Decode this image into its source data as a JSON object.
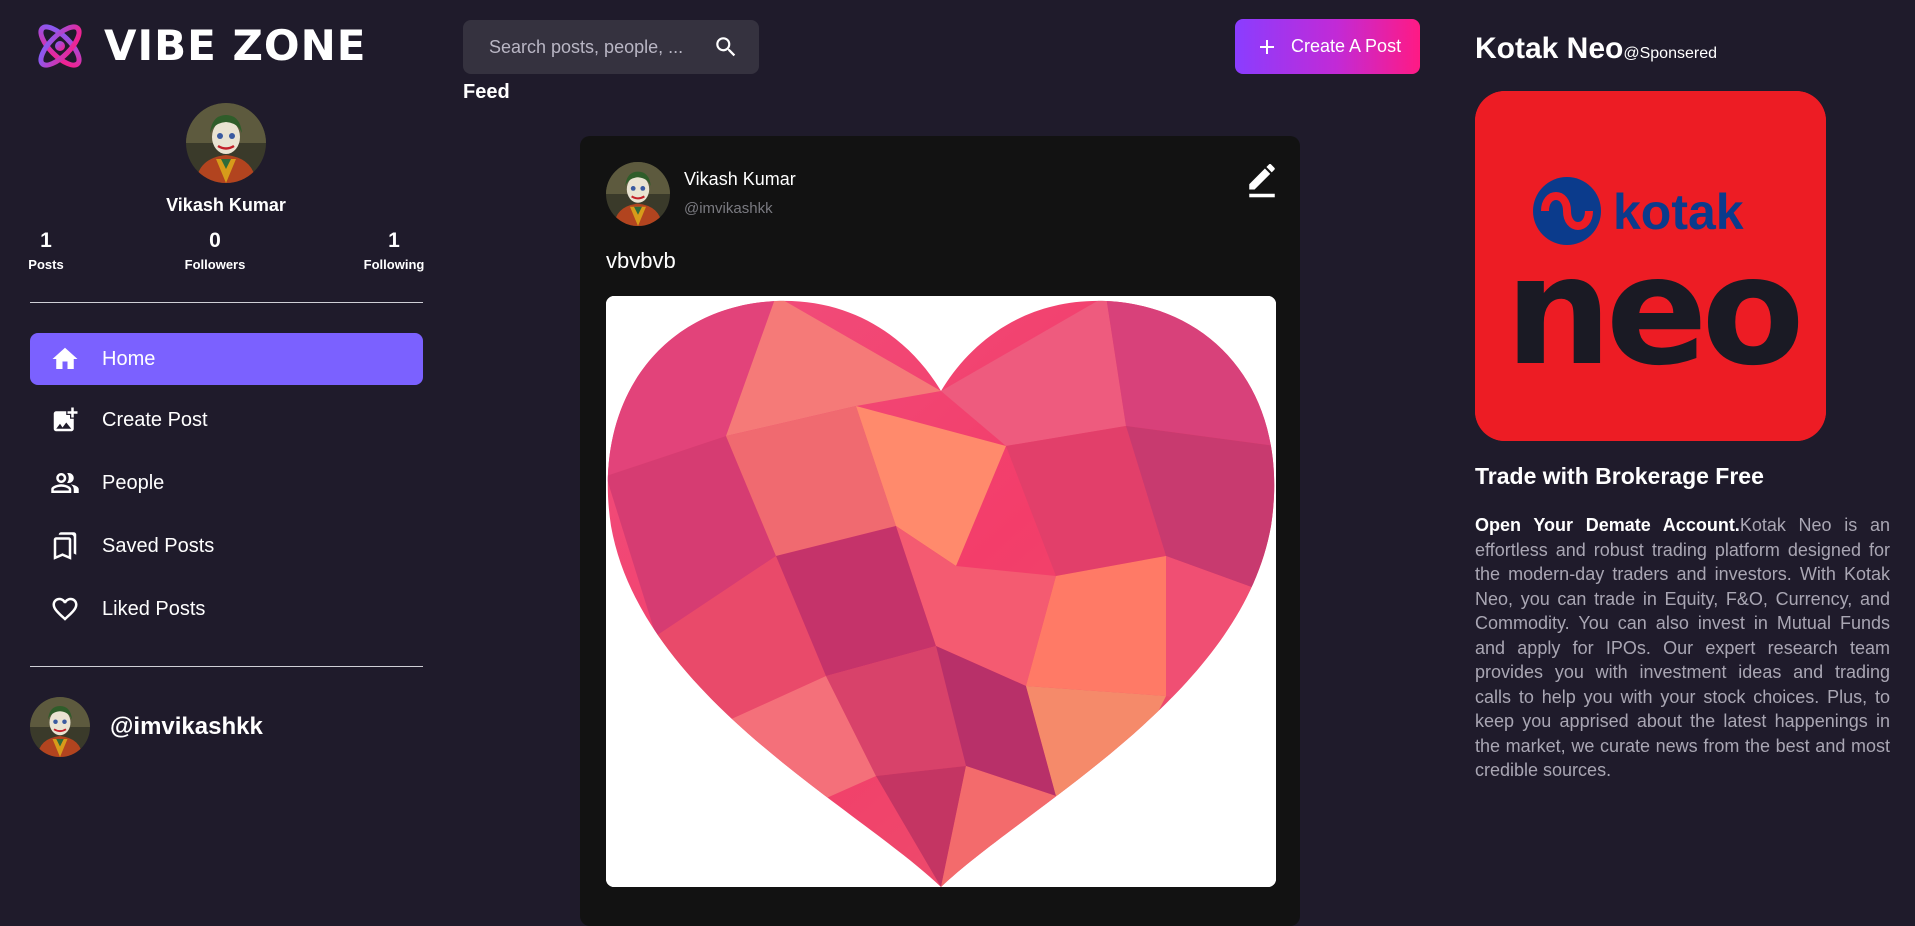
{
  "app": {
    "logo_text": "VIBE ZONE"
  },
  "profile": {
    "name": "Vikash Kumar",
    "handle": "@imvikashkk",
    "stats": [
      {
        "value": "1",
        "label": "Posts"
      },
      {
        "value": "0",
        "label": "Followers"
      },
      {
        "value": "1",
        "label": "Following"
      }
    ]
  },
  "nav": {
    "items": [
      {
        "label": "Home",
        "icon": "home-icon",
        "active": true
      },
      {
        "label": "Create Post",
        "icon": "add-photo-icon",
        "active": false
      },
      {
        "label": "People",
        "icon": "people-icon",
        "active": false
      },
      {
        "label": "Saved Posts",
        "icon": "bookmark-icon",
        "active": false
      },
      {
        "label": "Liked Posts",
        "icon": "heart-icon",
        "active": false
      }
    ]
  },
  "search": {
    "placeholder": "Search posts, people, ..."
  },
  "header": {
    "create_button": "Create A Post"
  },
  "feed": {
    "title": "Feed",
    "post": {
      "author_name": "Vikash Kumar",
      "author_handle": "@imvikashkk",
      "caption": "vbvbvb",
      "image": "low-poly pink heart"
    }
  },
  "sponsored": {
    "title": "Kotak Neo",
    "tag": "@Sponsered",
    "logo_word": "kotak",
    "logo_big": "neo",
    "headline": "Trade with Brokerage Free",
    "lead": "Open Your Demate Account.",
    "body": "Kotak Neo is an effortless and robust trading platform designed for the modern-day traders and investors. With Kotak Neo, you can trade in Equity, F&O, Currency, and Commodity. You can also invest in Mutual Funds and apply for IPOs. Our expert research team provides you with investment ideas and trading calls to help you with your stock choices. Plus, to keep you apprised about the latest happenings in the market, we curate news from the best and most credible sources."
  },
  "colors": {
    "background": "#1f1b2b",
    "accent": "#7b61ff",
    "card": "#121212",
    "ad_red": "#ed1c24",
    "gradient_start": "#8a3dff",
    "gradient_end": "#ff1a84"
  }
}
